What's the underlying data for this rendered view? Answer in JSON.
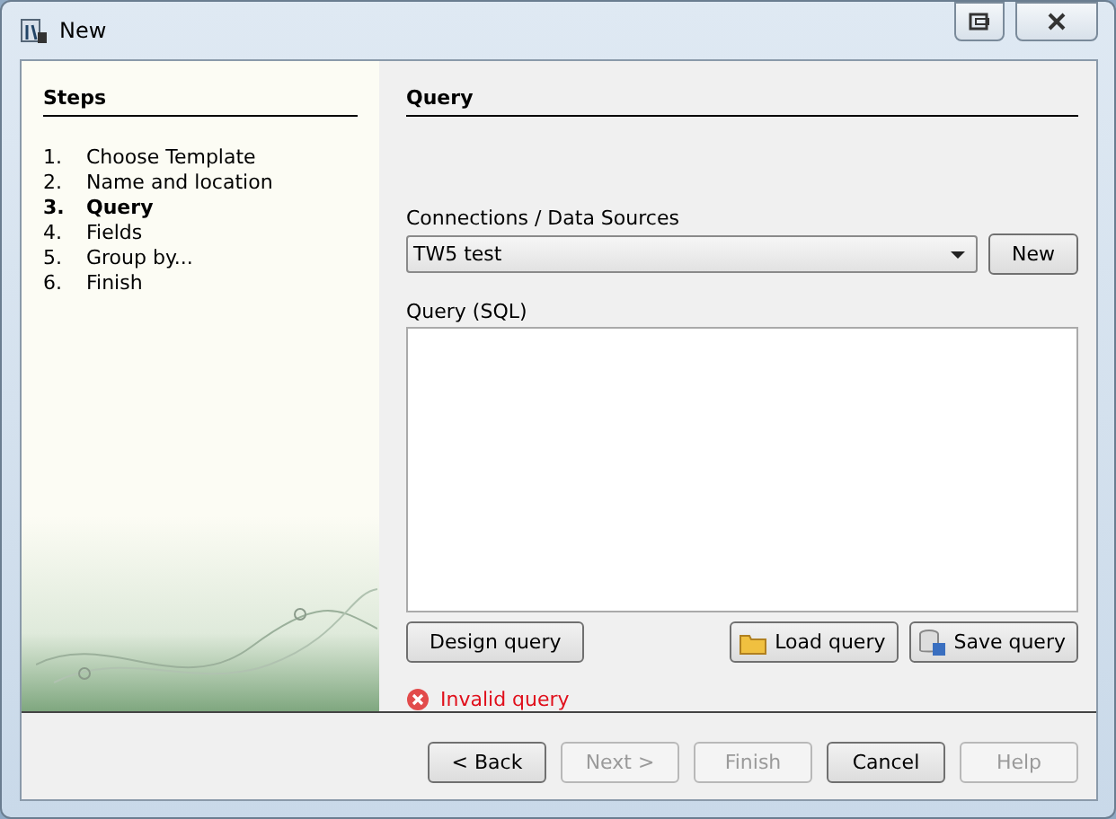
{
  "window": {
    "title": "New"
  },
  "steps": {
    "title": "Steps",
    "items": [
      {
        "number": "1.",
        "label": "Choose Template",
        "selected": false
      },
      {
        "number": "2.",
        "label": "Name and location",
        "selected": false
      },
      {
        "number": "3.",
        "label": "Query",
        "selected": true
      },
      {
        "number": "4.",
        "label": "Fields",
        "selected": false
      },
      {
        "number": "5.",
        "label": "Group by...",
        "selected": false
      },
      {
        "number": "6.",
        "label": "Finish",
        "selected": false
      }
    ]
  },
  "page": {
    "title": "Query",
    "connection_label": "Connections / Data Sources",
    "connection_value": "TW5 test",
    "new_button": "New",
    "query_label": "Query (SQL)",
    "design_button": "Design query",
    "load_button": "Load query",
    "save_button": "Save query",
    "error": "Invalid query"
  },
  "buttons": [
    {
      "label": "< Back",
      "disabled": false
    },
    {
      "label": "Next >",
      "disabled": true
    },
    {
      "label": "Finish",
      "disabled": true
    },
    {
      "label": "Cancel",
      "disabled": false
    },
    {
      "label": "Help",
      "disabled": true
    }
  ]
}
